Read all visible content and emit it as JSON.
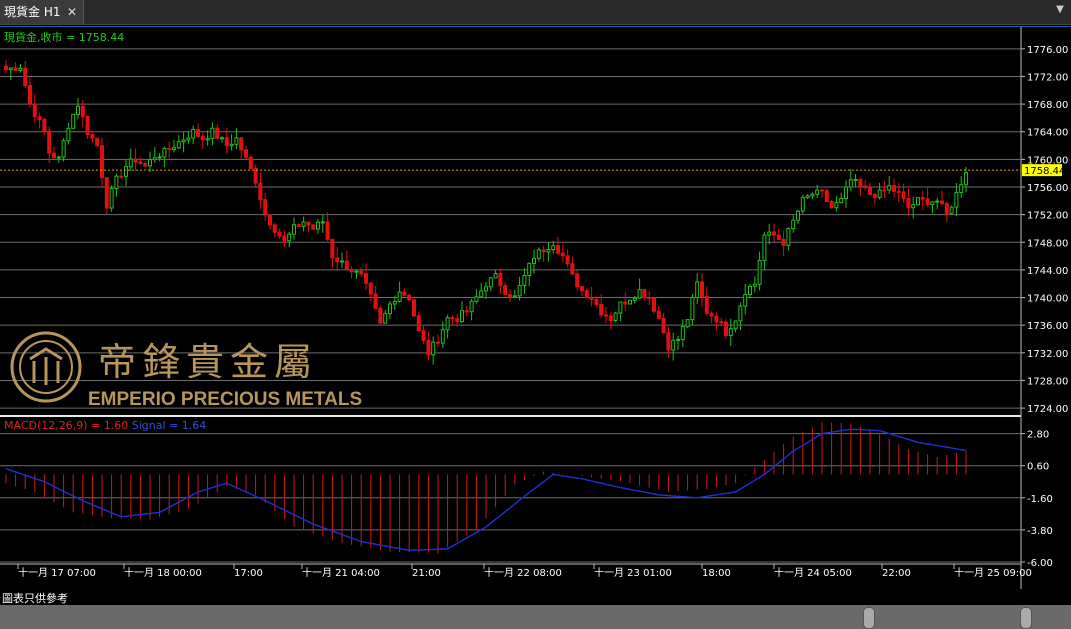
{
  "tab": {
    "title": "現貨金 H1",
    "close": "✕"
  },
  "price_legend": "現貨金,收市 = 1758.44",
  "macd_legend": {
    "macd": "MACD(12,26,9) = 1.60",
    "signal": "Signal = 1.64"
  },
  "current_price_label": "1758.44",
  "footer_note": "圖表只供參考",
  "watermark": {
    "cn": "帝鋒貴金屬",
    "en": "EMPERIO PRECIOUS METALS"
  },
  "colors": {
    "bull": "#1fc01f",
    "bear": "#e01010",
    "grid": "#6e6e6e",
    "axis_text": "#ffffff",
    "price_label_bg": "#ffff00",
    "current_line": "#e0a020",
    "macd_hist": "#d01818",
    "signal": "#2030d0",
    "legend_price": "#22cc22",
    "legend_macd": "#e02020",
    "legend_signal": "#3050e0"
  },
  "chart_data": [
    {
      "type": "candlestick",
      "series": [
        {
          "name": "現貨金"
        }
      ],
      "y_ticks": [
        "1776.00",
        "1772.00",
        "1768.00",
        "1764.00",
        "1760.00",
        "1756.00",
        "1752.00",
        "1748.00",
        "1744.00",
        "1740.00",
        "1736.00",
        "1732.00",
        "1728.00",
        "1724.00"
      ],
      "ylim": [
        1723,
        1778
      ],
      "current_price": 1758.44,
      "x_ticks": [
        {
          "label": "十一月 17 07:00",
          "x": 18
        },
        {
          "label": "十一月 18 00:00",
          "x": 124
        },
        {
          "label": "17:00",
          "x": 234
        },
        {
          "label": "十一月 21 04:00",
          "x": 302
        },
        {
          "label": "21:00",
          "x": 412
        },
        {
          "label": "十一月 22 08:00",
          "x": 484
        },
        {
          "label": "十一月 23 01:00",
          "x": 594
        },
        {
          "label": "18:00",
          "x": 702
        },
        {
          "label": "十一月 24 05:00",
          "x": 774
        },
        {
          "label": "22:00",
          "x": 882
        },
        {
          "label": "十一月 25 09:00",
          "x": 954
        }
      ],
      "anchor_closes": [
        [
          0,
          1773
        ],
        [
          3,
          1773.5
        ],
        [
          5,
          1768
        ],
        [
          8,
          1764
        ],
        [
          9,
          1761
        ],
        [
          11,
          1760
        ],
        [
          13,
          1765
        ],
        [
          15,
          1768
        ],
        [
          17,
          1764
        ],
        [
          19,
          1762
        ],
        [
          21,
          1753.5
        ],
        [
          23,
          1757
        ],
        [
          25,
          1759
        ],
        [
          27,
          1760
        ],
        [
          29,
          1759
        ],
        [
          31,
          1760.5
        ],
        [
          33,
          1761
        ],
        [
          35,
          1762
        ],
        [
          37,
          1763
        ],
        [
          39,
          1764
        ],
        [
          41,
          1763
        ],
        [
          43,
          1764
        ],
        [
          46,
          1762
        ],
        [
          48,
          1763
        ],
        [
          50,
          1760
        ],
        [
          52,
          1757
        ],
        [
          54,
          1752
        ],
        [
          56,
          1750
        ],
        [
          58,
          1748
        ],
        [
          60,
          1750
        ],
        [
          62,
          1751
        ],
        [
          64,
          1750
        ],
        [
          66,
          1751
        ],
        [
          68,
          1746
        ],
        [
          70,
          1745
        ],
        [
          72,
          1744
        ],
        [
          74,
          1743
        ],
        [
          76,
          1740
        ],
        [
          78,
          1736
        ],
        [
          80,
          1739
        ],
        [
          82,
          1741
        ],
        [
          84,
          1740
        ],
        [
          86,
          1735
        ],
        [
          88,
          1732
        ],
        [
          90,
          1734
        ],
        [
          92,
          1737
        ],
        [
          94,
          1737
        ],
        [
          96,
          1738
        ],
        [
          98,
          1740
        ],
        [
          100,
          1742
        ],
        [
          102,
          1743
        ],
        [
          104,
          1741
        ],
        [
          106,
          1740
        ],
        [
          108,
          1743
        ],
        [
          110,
          1746
        ],
        [
          112,
          1747
        ],
        [
          114,
          1748
        ],
        [
          116,
          1746
        ],
        [
          118,
          1743
        ],
        [
          120,
          1741
        ],
        [
          122,
          1740
        ],
        [
          124,
          1738
        ],
        [
          126,
          1737
        ],
        [
          128,
          1739
        ],
        [
          130,
          1740
        ],
        [
          132,
          1741
        ],
        [
          134,
          1740
        ],
        [
          136,
          1737
        ],
        [
          138,
          1733
        ],
        [
          140,
          1734
        ],
        [
          142,
          1737
        ],
        [
          144,
          1742
        ],
        [
          146,
          1738
        ],
        [
          148,
          1737
        ],
        [
          150,
          1735
        ],
        [
          152,
          1737
        ],
        [
          154,
          1741
        ],
        [
          156,
          1742
        ],
        [
          158,
          1749
        ],
        [
          160,
          1749
        ],
        [
          162,
          1748
        ],
        [
          164,
          1751
        ],
        [
          166,
          1754
        ],
        [
          168,
          1755
        ],
        [
          170,
          1755
        ],
        [
          172,
          1753
        ],
        [
          174,
          1754
        ],
        [
          176,
          1757
        ],
        [
          178,
          1756
        ],
        [
          180,
          1755
        ],
        [
          182,
          1755
        ],
        [
          184,
          1756
        ],
        [
          186,
          1755
        ],
        [
          188,
          1753
        ],
        [
          190,
          1754
        ],
        [
          192,
          1754
        ],
        [
          194,
          1754
        ],
        [
          196,
          1752
        ],
        [
          198,
          1755
        ],
        [
          200,
          1758.44
        ]
      ]
    },
    {
      "type": "bar",
      "series": [
        {
          "name": "MACD(12,26,9)"
        },
        {
          "name": "Signal"
        }
      ],
      "y_ticks": [
        "2.80",
        "0.60",
        "-1.60",
        "-3.80",
        "-6.00"
      ],
      "ylim": [
        -6.0,
        3.8
      ],
      "macd_anchors": [
        [
          0,
          -0.6
        ],
        [
          6,
          -1.2
        ],
        [
          14,
          -2.6
        ],
        [
          22,
          -3.0
        ],
        [
          30,
          -3.1
        ],
        [
          38,
          -2.4
        ],
        [
          46,
          -0.8
        ],
        [
          52,
          -1.4
        ],
        [
          60,
          -3.6
        ],
        [
          70,
          -4.7
        ],
        [
          80,
          -5.3
        ],
        [
          90,
          -5.4
        ],
        [
          98,
          -3.8
        ],
        [
          106,
          -0.7
        ],
        [
          112,
          0.2
        ],
        [
          120,
          -0.1
        ],
        [
          130,
          -0.6
        ],
        [
          138,
          -1.2
        ],
        [
          146,
          -1.0
        ],
        [
          152,
          -0.6
        ],
        [
          158,
          1.0
        ],
        [
          164,
          2.6
        ],
        [
          170,
          3.6
        ],
        [
          176,
          3.5
        ],
        [
          182,
          2.8
        ],
        [
          188,
          1.7
        ],
        [
          194,
          1.2
        ],
        [
          200,
          1.6
        ]
      ],
      "signal_anchors": [
        [
          0,
          0.4
        ],
        [
          8,
          -0.5
        ],
        [
          16,
          -1.8
        ],
        [
          24,
          -2.9
        ],
        [
          32,
          -2.6
        ],
        [
          40,
          -1.2
        ],
        [
          46,
          -0.6
        ],
        [
          54,
          -1.8
        ],
        [
          64,
          -3.4
        ],
        [
          74,
          -4.6
        ],
        [
          84,
          -5.2
        ],
        [
          92,
          -5.1
        ],
        [
          100,
          -3.6
        ],
        [
          108,
          -1.5
        ],
        [
          114,
          0.0
        ],
        [
          120,
          -0.3
        ],
        [
          128,
          -0.9
        ],
        [
          136,
          -1.4
        ],
        [
          144,
          -1.6
        ],
        [
          152,
          -1.2
        ],
        [
          158,
          0.0
        ],
        [
          164,
          1.6
        ],
        [
          170,
          2.8
        ],
        [
          176,
          3.1
        ],
        [
          182,
          3.0
        ],
        [
          190,
          2.2
        ],
        [
          200,
          1.64
        ]
      ]
    }
  ]
}
